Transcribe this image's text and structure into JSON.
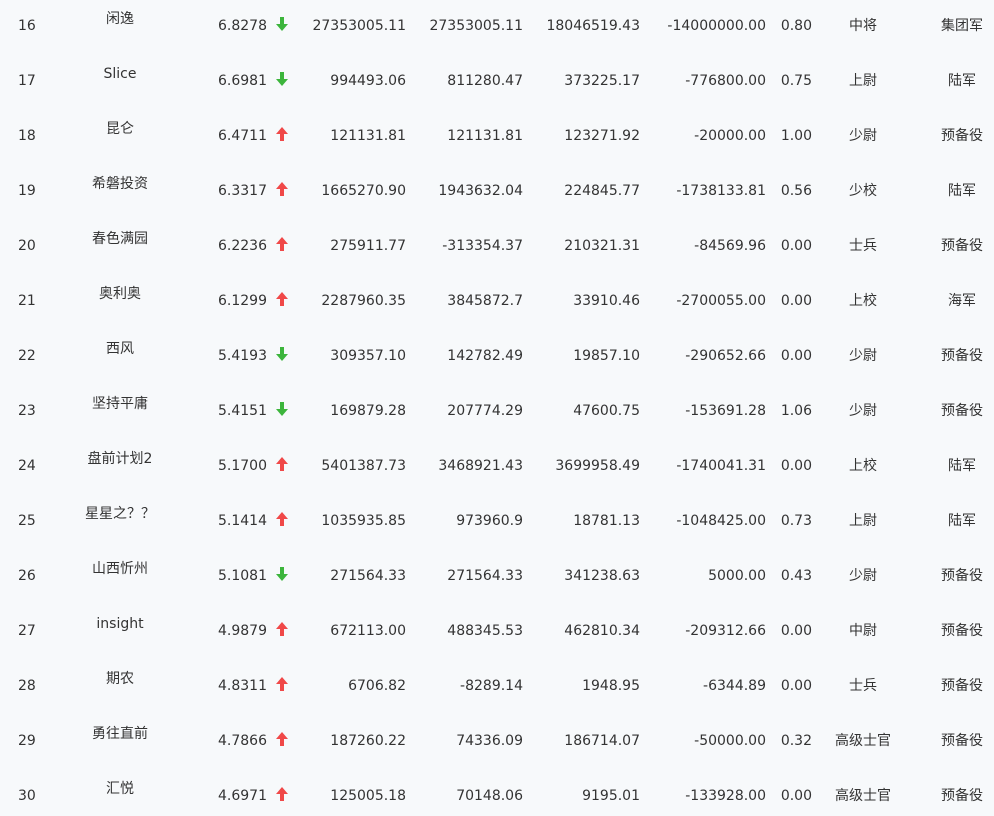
{
  "colors": {
    "up": "#f04848",
    "down": "#3cb53c",
    "text": "#333333",
    "background": "#f7f9fb"
  },
  "rows": [
    {
      "rank": "16",
      "name": "闲逸",
      "score": "6.8278",
      "trend": "down",
      "v1": "27353005.11",
      "v2": "27353005.11",
      "v3": "18046519.43",
      "v4": "-14000000.00",
      "ratio": "0.80",
      "title": "中将",
      "branch": "集团军"
    },
    {
      "rank": "17",
      "name": "Slice",
      "score": "6.6981",
      "trend": "down",
      "v1": "994493.06",
      "v2": "811280.47",
      "v3": "373225.17",
      "v4": "-776800.00",
      "ratio": "0.75",
      "title": "上尉",
      "branch": "陆军"
    },
    {
      "rank": "18",
      "name": "昆仑",
      "score": "6.4711",
      "trend": "up",
      "v1": "121131.81",
      "v2": "121131.81",
      "v3": "123271.92",
      "v4": "-20000.00",
      "ratio": "1.00",
      "title": "少尉",
      "branch": "预备役"
    },
    {
      "rank": "19",
      "name": "希磐投资",
      "score": "6.3317",
      "trend": "up",
      "v1": "1665270.90",
      "v2": "1943632.04",
      "v3": "224845.77",
      "v4": "-1738133.81",
      "ratio": "0.56",
      "title": "少校",
      "branch": "陆军"
    },
    {
      "rank": "20",
      "name": "春色满园",
      "score": "6.2236",
      "trend": "up",
      "v1": "275911.77",
      "v2": "-313354.37",
      "v3": "210321.31",
      "v4": "-84569.96",
      "ratio": "0.00",
      "title": "士兵",
      "branch": "预备役"
    },
    {
      "rank": "21",
      "name": "奥利奥",
      "score": "6.1299",
      "trend": "up",
      "v1": "2287960.35",
      "v2": "3845872.7",
      "v3": "33910.46",
      "v4": "-2700055.00",
      "ratio": "0.00",
      "title": "上校",
      "branch": "海军"
    },
    {
      "rank": "22",
      "name": "西风",
      "score": "5.4193",
      "trend": "down",
      "v1": "309357.10",
      "v2": "142782.49",
      "v3": "19857.10",
      "v4": "-290652.66",
      "ratio": "0.00",
      "title": "少尉",
      "branch": "预备役"
    },
    {
      "rank": "23",
      "name": "坚持平庸",
      "score": "5.4151",
      "trend": "down",
      "v1": "169879.28",
      "v2": "207774.29",
      "v3": "47600.75",
      "v4": "-153691.28",
      "ratio": "1.06",
      "title": "少尉",
      "branch": "预备役"
    },
    {
      "rank": "24",
      "name": "盘前计划2",
      "score": "5.1700",
      "trend": "up",
      "v1": "5401387.73",
      "v2": "3468921.43",
      "v3": "3699958.49",
      "v4": "-1740041.31",
      "ratio": "0.00",
      "title": "上校",
      "branch": "陆军"
    },
    {
      "rank": "25",
      "name": "星星之？？",
      "score": "5.1414",
      "trend": "up",
      "v1": "1035935.85",
      "v2": "973960.9",
      "v3": "18781.13",
      "v4": "-1048425.00",
      "ratio": "0.73",
      "title": "上尉",
      "branch": "陆军"
    },
    {
      "rank": "26",
      "name": "山西忻州",
      "score": "5.1081",
      "trend": "down",
      "v1": "271564.33",
      "v2": "271564.33",
      "v3": "341238.63",
      "v4": "5000.00",
      "ratio": "0.43",
      "title": "少尉",
      "branch": "预备役"
    },
    {
      "rank": "27",
      "name": "insight",
      "score": "4.9879",
      "trend": "up",
      "v1": "672113.00",
      "v2": "488345.53",
      "v3": "462810.34",
      "v4": "-209312.66",
      "ratio": "0.00",
      "title": "中尉",
      "branch": "预备役"
    },
    {
      "rank": "28",
      "name": "期农",
      "score": "4.8311",
      "trend": "up",
      "v1": "6706.82",
      "v2": "-8289.14",
      "v3": "1948.95",
      "v4": "-6344.89",
      "ratio": "0.00",
      "title": "士兵",
      "branch": "预备役"
    },
    {
      "rank": "29",
      "name": "勇往直前",
      "score": "4.7866",
      "trend": "up",
      "v1": "187260.22",
      "v2": "74336.09",
      "v3": "186714.07",
      "v4": "-50000.00",
      "ratio": "0.32",
      "title": "高级士官",
      "branch": "预备役"
    },
    {
      "rank": "30",
      "name": "汇悦",
      "score": "4.6971",
      "trend": "up",
      "v1": "125005.18",
      "v2": "70148.06",
      "v3": "9195.01",
      "v4": "-133928.00",
      "ratio": "0.00",
      "title": "高级士官",
      "branch": "预备役"
    }
  ]
}
